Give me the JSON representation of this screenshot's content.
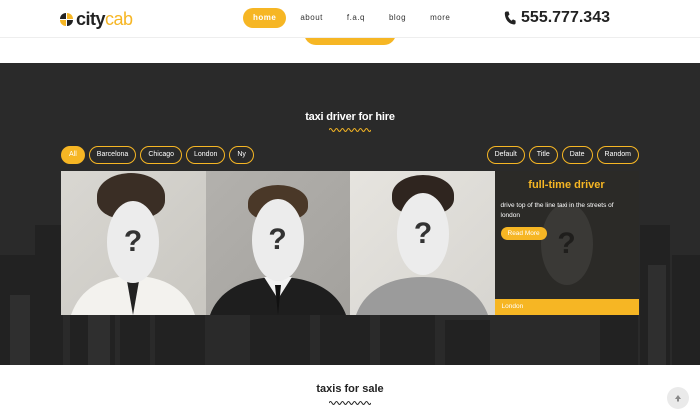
{
  "brand": {
    "city": "city",
    "cab": "cab"
  },
  "nav": {
    "items": [
      {
        "label": "home",
        "active": true
      },
      {
        "label": "about"
      },
      {
        "label": "f.a.q"
      },
      {
        "label": "blog"
      },
      {
        "label": "more"
      }
    ]
  },
  "header": {
    "phone": "555.777.343",
    "phone_icon": "phone-icon"
  },
  "colors": {
    "accent": "#f6b624",
    "dark": "#2a2a2a"
  },
  "drivers": {
    "title": "taxi driver for hire",
    "filters_left": [
      "All",
      "Barcelona",
      "Chicago",
      "London",
      "Ny"
    ],
    "filters_right": [
      "Default",
      "Title",
      "Date",
      "Random"
    ],
    "placeholder": "?",
    "info": {
      "title": "full-time driver",
      "description": "drive top of the line taxi in the streets of london",
      "button": "Read More",
      "location": "London"
    }
  },
  "sale": {
    "title": "taxis for sale"
  },
  "scroll_top_icon": "arrow-up-icon"
}
